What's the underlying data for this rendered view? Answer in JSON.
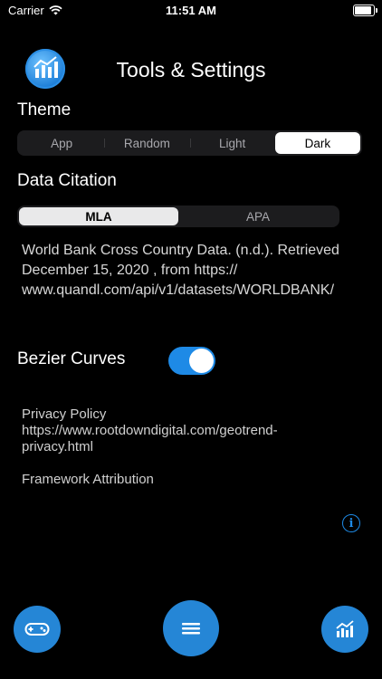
{
  "status": {
    "carrier": "Carrier",
    "time": "11:51 AM"
  },
  "header": {
    "title": "Tools & Settings"
  },
  "theme": {
    "label": "Theme",
    "options": [
      "App",
      "Random",
      "Light",
      "Dark"
    ],
    "selected": "Dark"
  },
  "citation": {
    "label": "Data Citation",
    "options": [
      "MLA",
      "APA"
    ],
    "selected": "MLA",
    "text": "World Bank Cross Country Data. (n.d.). Retrieved December 15, 2020 , from https:// www.quandl.com/api/v1/datasets/WORLDBANK/"
  },
  "bezier": {
    "label": "Bezier Curves",
    "enabled": true
  },
  "links": {
    "privacy_title": "Privacy Policy",
    "privacy_url": "https://www.rootdowndigital.com/geotrend-privacy.html",
    "framework": "Framework Attribution"
  },
  "colors": {
    "accent": "#2586d6",
    "toggle_on": "#1e8ae6",
    "background": "#000000"
  },
  "icons": {
    "info": "info-icon",
    "left_fab": "gamepad-icon",
    "center_fab": "menu-icon",
    "right_fab": "chart-icon"
  }
}
